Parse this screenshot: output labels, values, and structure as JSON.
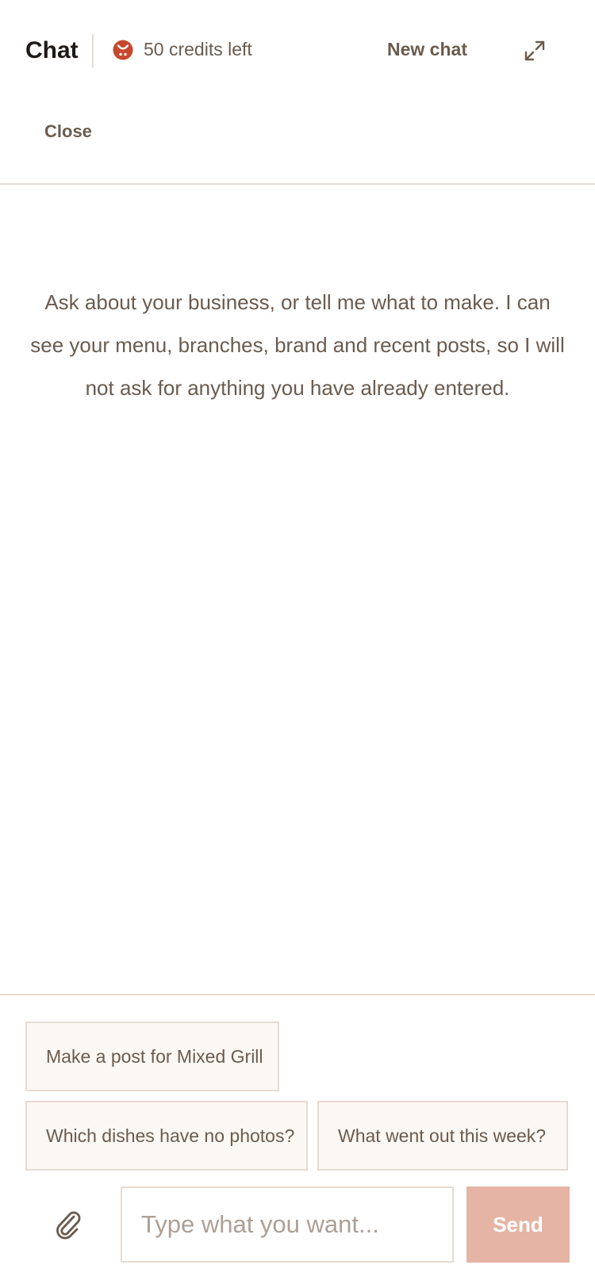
{
  "header": {
    "title": "Chat",
    "credits_text": "50 credits left",
    "credits_icon": "brand-logo-icon",
    "new_chat_label": "New chat",
    "expand_icon": "expand-icon",
    "close_label": "Close"
  },
  "intro": {
    "text": "Ask about your business, or tell me what to make. I can see your menu, branches, brand and recent posts, so I will not ask for anything you have already entered."
  },
  "suggestions": [
    {
      "label": "Make a post for Mixed Grill"
    },
    {
      "label": "Which dishes have no photos?"
    },
    {
      "label": "What went out this week?"
    }
  ],
  "composer": {
    "attach_icon": "paperclip-icon",
    "placeholder": "Type what you want...",
    "value": "",
    "send_label": "Send"
  },
  "colors": {
    "accent": "#c7472c",
    "send_disabled": "#e5b4a4",
    "border": "#e6dbd3",
    "chip_bg": "#fbf8f3",
    "text": "#6b5b4e",
    "title": "#1f1a17"
  }
}
